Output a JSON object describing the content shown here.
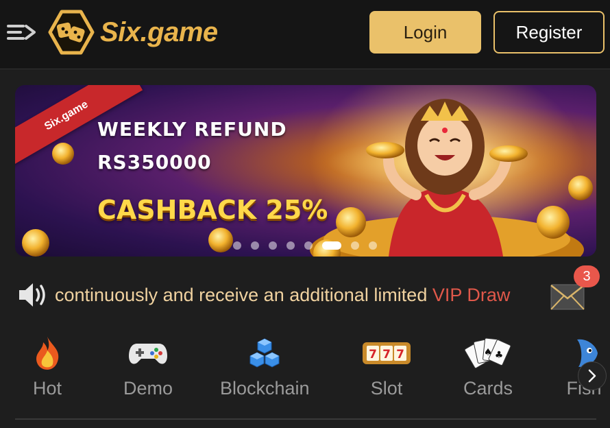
{
  "header": {
    "brand": "Six.game",
    "login_label": "Login",
    "register_label": "Register",
    "menu_icon": "menu-collapse-icon"
  },
  "banner": {
    "ribbon_text": "Six.game",
    "line1": "WEEKLY REFUND",
    "line2": "RS350000",
    "line3": "CASHBACK 25%",
    "slide_count": 8,
    "active_slide": 6
  },
  "notice": {
    "text_main": "continuously and receive an additional limited ",
    "text_highlight": "VIP Draw",
    "mail_badge": "3"
  },
  "categories": [
    {
      "label": "Hot",
      "icon": "flame-icon"
    },
    {
      "label": "Demo",
      "icon": "gamepad-icon"
    },
    {
      "label": "Blockchain",
      "icon": "cubes-icon"
    },
    {
      "label": "Slot",
      "icon": "slot-machine-icon"
    },
    {
      "label": "Cards",
      "icon": "playing-cards-icon"
    },
    {
      "label": "Fish",
      "icon": "fish-icon"
    }
  ],
  "colors": {
    "accent": "#eac16a",
    "brand": "#e9b44c",
    "highlight": "#e0584a",
    "badge": "#e9574b"
  }
}
